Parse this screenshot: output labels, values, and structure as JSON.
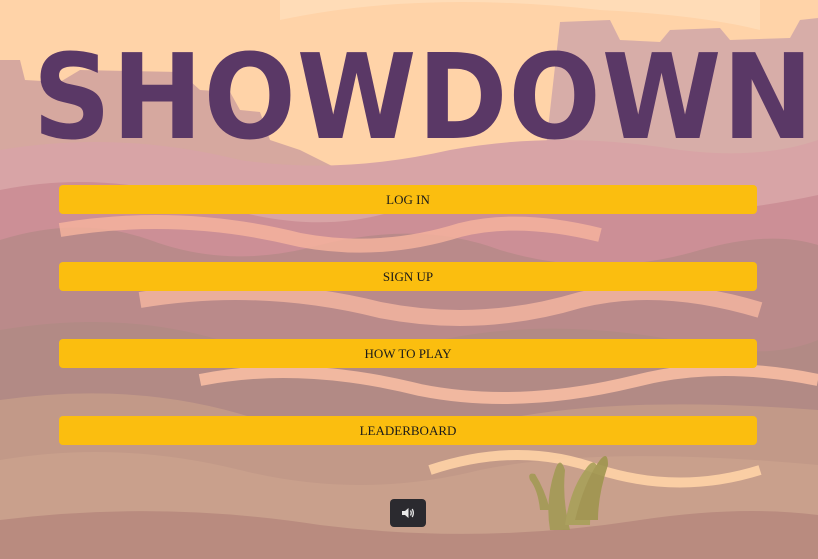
{
  "title": "SHOWDOWN",
  "menu": {
    "login_label": "LOG IN",
    "signup_label": "SIGN UP",
    "how_to_play_label": "HOW TO PLAY",
    "leaderboard_label": "LEADERBOARD"
  },
  "sound": {
    "icon": "volume-icon"
  },
  "colors": {
    "title": "#5a3866",
    "button": "#fbbe0f",
    "sound_button": "#2b2a2f",
    "sky": "#ffd2a6"
  }
}
